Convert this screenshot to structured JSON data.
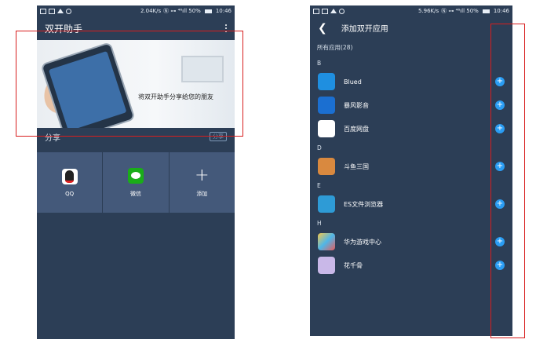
{
  "left": {
    "status": {
      "speed": "2.04K/s",
      "right": "Ⓝ ⊶ ⁴⁶ıll 50%",
      "time": "10:46"
    },
    "title": "双开助手",
    "banner_text": "将双开助手分享给您的朋友",
    "share_label": "分享",
    "share_button": "分享",
    "apps": [
      {
        "label": "QQ"
      },
      {
        "label": "微信"
      },
      {
        "label": "添加"
      }
    ]
  },
  "right": {
    "status": {
      "speed": "5.96K/s",
      "right": "Ⓝ ⊶ ⁴⁶ıll 50%",
      "time": "10:46"
    },
    "title": "添加双开应用",
    "section": "所有应用(28)",
    "letters": {
      "b": "B",
      "d": "D",
      "e": "E",
      "h": "H"
    },
    "apps": [
      {
        "name": "Blued",
        "color": "#1f8fe0"
      },
      {
        "name": "暴风影音",
        "color": "#1b6fd1"
      },
      {
        "name": "百度网盘",
        "color": "#ffffff"
      },
      {
        "name": "斗鱼三国",
        "color": "#d9893f"
      },
      {
        "name": "ES文件浏览器",
        "color": "#2e9bd6"
      },
      {
        "name": "华为游戏中心",
        "color": "#ffffff"
      },
      {
        "name": "花千骨",
        "color": "#c9b8e8"
      }
    ]
  }
}
